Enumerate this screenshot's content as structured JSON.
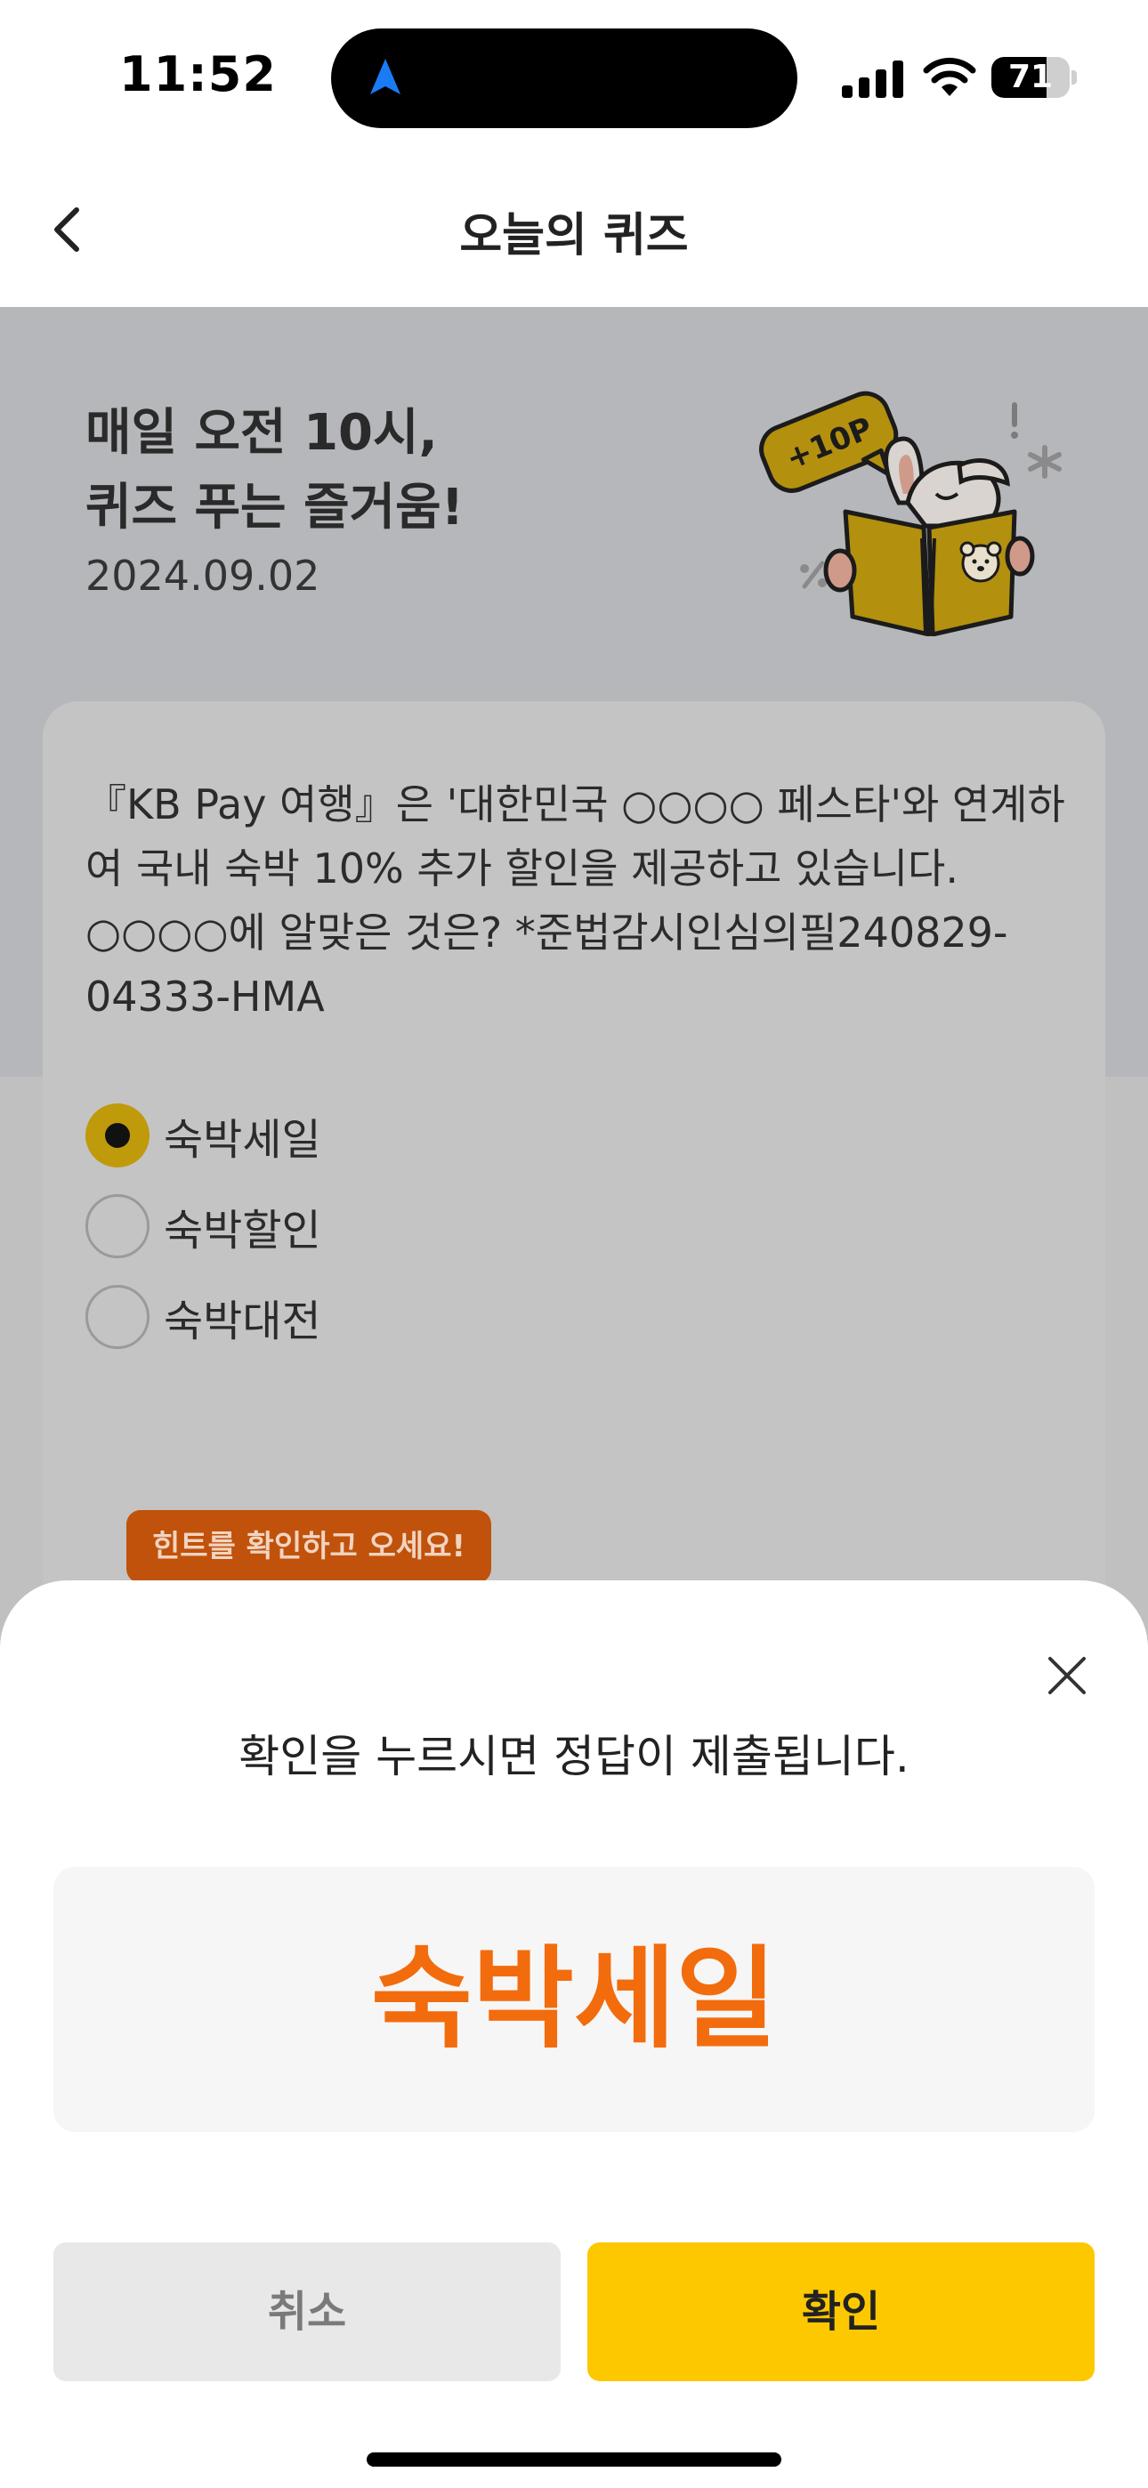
{
  "status_bar": {
    "time": "11:52",
    "battery_level": "71",
    "battery_fraction": 0.71,
    "icons": [
      "location-arrow-icon",
      "cellular-signal-icon",
      "wifi-icon",
      "battery-icon"
    ],
    "location_color": "#1a7cf5"
  },
  "header": {
    "title": "오늘의 퀴즈",
    "back_icon": "chevron-left-icon"
  },
  "hero": {
    "title_line1": "매일 오전 10시,",
    "title_line2": "퀴즈 푸는 즐거움!",
    "date": "2024.09.02",
    "badge": "+10P"
  },
  "question": {
    "text": "『KB Pay 여행』은 '대한민국 ○○○○ 페스타'와 연계하여 국내 숙박 10% 추가 할인을 제공하고 있습니다. ○○○○에 알맞은 것은? *준법감시인심의필240829-04333-HMA"
  },
  "options": [
    {
      "label": "숙박세일",
      "selected": true
    },
    {
      "label": "숙박할인",
      "selected": false
    },
    {
      "label": "숙박대전",
      "selected": false
    }
  ],
  "hint_button": "힌트를 확인하고 오세요!",
  "sheet": {
    "message": "확인을 누르시면 정답이 제출됩니다.",
    "answer": "숙박세일",
    "cancel_label": "취소",
    "confirm_label": "확인",
    "close_icon": "close-icon"
  },
  "colors": {
    "accent_yellow": "#fdc800",
    "answer_orange": "#f26c0d",
    "hint_orange": "#c0520b",
    "dim_overlay": "#c0c0c0"
  }
}
